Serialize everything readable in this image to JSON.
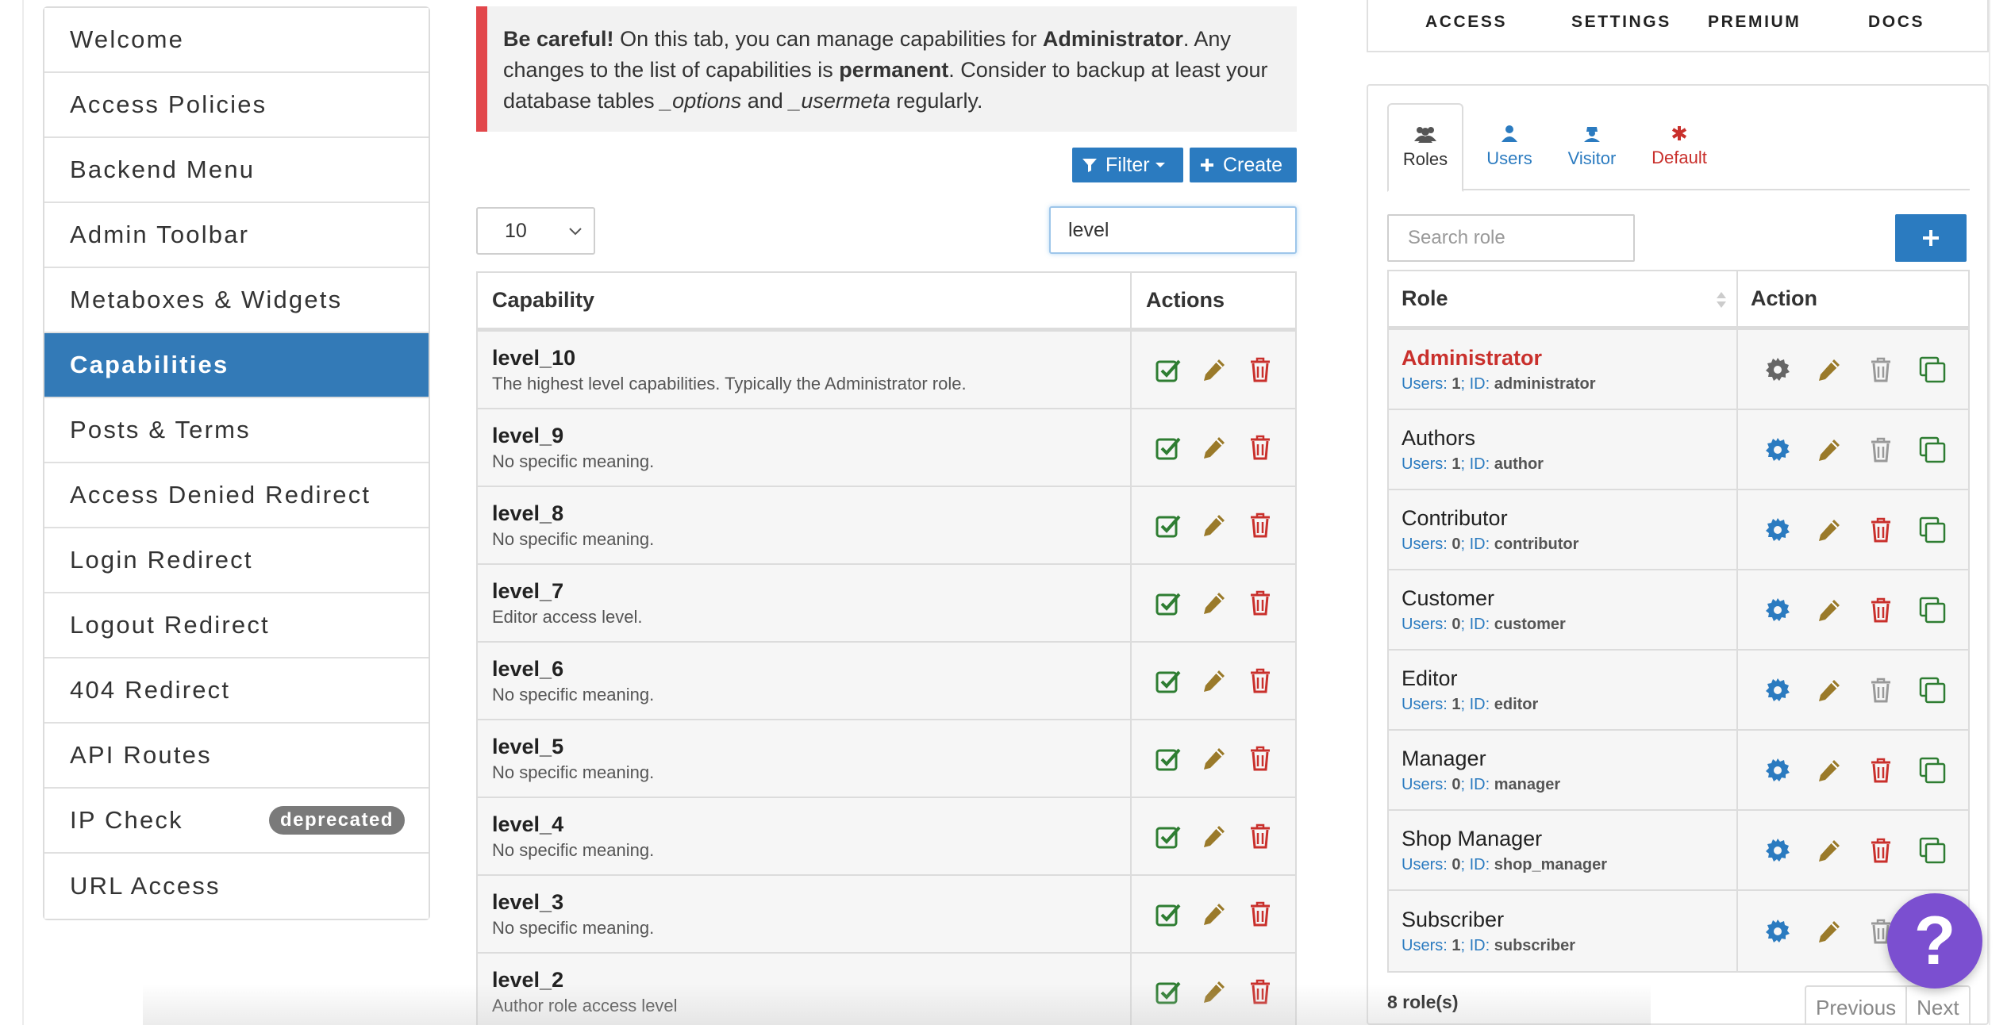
{
  "sidebar": {
    "items": [
      {
        "label": "Welcome"
      },
      {
        "label": "Access Policies"
      },
      {
        "label": "Backend Menu"
      },
      {
        "label": "Admin Toolbar"
      },
      {
        "label": "Metaboxes & Widgets"
      },
      {
        "label": "Capabilities",
        "active": true
      },
      {
        "label": "Posts & Terms"
      },
      {
        "label": "Access Denied Redirect"
      },
      {
        "label": "Login Redirect"
      },
      {
        "label": "Logout Redirect"
      },
      {
        "label": "404 Redirect"
      },
      {
        "label": "API Routes"
      },
      {
        "label": "IP Check",
        "badge": "deprecated"
      },
      {
        "label": "URL Access"
      }
    ]
  },
  "alert": {
    "strong": "Be careful!",
    "text1": " On this tab, you can manage capabilities for ",
    "role": "Administrator",
    "text2": ". Any changes to the list of capabilities is ",
    "permanent": "permanent",
    "text3": ". Consider to backup at least your database tables ",
    "table1": "_options",
    "text4": " and ",
    "table2": "_usermeta",
    "text5": " regularly."
  },
  "toolbar": {
    "filter_label": "Filter",
    "create_label": "Create",
    "page_size": "10",
    "search_value": "level"
  },
  "capabilities": {
    "headers": {
      "capability": "Capability",
      "actions": "Actions"
    },
    "rows": [
      {
        "name": "level_10",
        "desc": "The highest level capabilities. Typically the Administrator role."
      },
      {
        "name": "level_9",
        "desc": "No specific meaning."
      },
      {
        "name": "level_8",
        "desc": "No specific meaning."
      },
      {
        "name": "level_7",
        "desc": "Editor access level."
      },
      {
        "name": "level_6",
        "desc": "No specific meaning."
      },
      {
        "name": "level_5",
        "desc": "No specific meaning."
      },
      {
        "name": "level_4",
        "desc": "No specific meaning."
      },
      {
        "name": "level_3",
        "desc": "No specific meaning."
      },
      {
        "name": "level_2",
        "desc": "Author role access level"
      }
    ]
  },
  "top_nav": {
    "access": "ACCESS",
    "settings": "SETTINGS",
    "premium": "PREMIUM",
    "docs": "DOCS"
  },
  "subject_tabs": {
    "roles": "Roles",
    "users": "Users",
    "visitor": "Visitor",
    "default": "Default"
  },
  "roles": {
    "search_placeholder": "Search role",
    "headers": {
      "role": "Role",
      "action": "Action"
    },
    "users_label": "Users:",
    "id_label": "ID:",
    "rows": [
      {
        "name": "Administrator",
        "users": "1",
        "id": "administrator",
        "current": true
      },
      {
        "name": "Authors",
        "users": "1",
        "id": "author"
      },
      {
        "name": "Contributor",
        "users": "0",
        "id": "contributor"
      },
      {
        "name": "Customer",
        "users": "0",
        "id": "customer"
      },
      {
        "name": "Editor",
        "users": "1",
        "id": "editor"
      },
      {
        "name": "Manager",
        "users": "0",
        "id": "manager"
      },
      {
        "name": "Shop Manager",
        "users": "0",
        "id": "shop_manager"
      },
      {
        "name": "Subscriber",
        "users": "1",
        "id": "subscriber"
      }
    ],
    "count_label": "8 role(s)",
    "previous_label": "Previous",
    "next_label": "Next"
  },
  "help": {
    "symbol": "?"
  },
  "colors": {
    "accent": "#2b7bc0",
    "active_menu": "#337ab7",
    "danger": "#c9302c",
    "success": "#2e7d32",
    "edit": "#9a7a2a",
    "help": "#7b4fd0"
  }
}
